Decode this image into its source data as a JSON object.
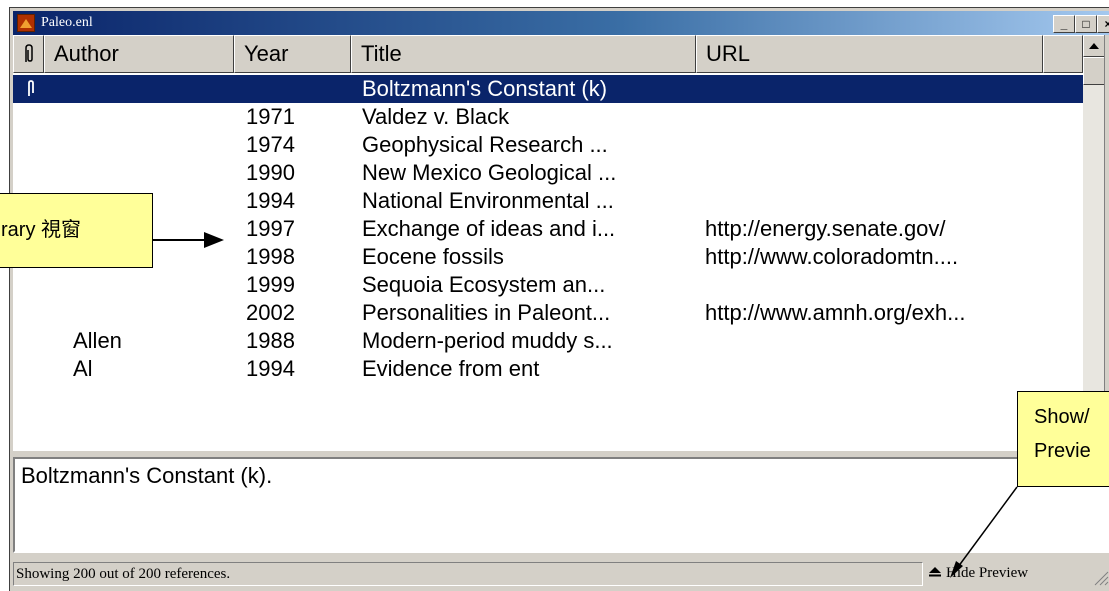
{
  "window": {
    "title": "Paleo.enl",
    "controls": {
      "minimize": "_",
      "maximize": "□",
      "close": "×"
    }
  },
  "columns": [
    {
      "label": "0"
    },
    {
      "label": "Author"
    },
    {
      "label": "Year"
    },
    {
      "label": "Title"
    },
    {
      "label": "URL"
    }
  ],
  "rows": [
    {
      "author": "",
      "year": "",
      "title": "Boltzmann's Constant (k)",
      "url": "",
      "selected": true
    },
    {
      "author": "",
      "year": "1971",
      "title": "Valdez v. Black",
      "url": ""
    },
    {
      "author": "",
      "year": "1974",
      "title": "Geophysical Research ...",
      "url": ""
    },
    {
      "author": "",
      "year": "1990",
      "title": "New Mexico Geological ...",
      "url": ""
    },
    {
      "author": "",
      "year": "1994",
      "title": "National Environmental ...",
      "url": ""
    },
    {
      "author": "",
      "year": "1997",
      "title": "Exchange of ideas and i...",
      "url": "http://energy.senate.gov/"
    },
    {
      "author": "",
      "year": "1998",
      "title": "Eocene fossils",
      "url": "http://www.coloradomtn...."
    },
    {
      "author": "",
      "year": "1999",
      "title": "Sequoia Ecosystem an...",
      "url": ""
    },
    {
      "author": "",
      "year": "2002",
      "title": "Personalities in Paleont...",
      "url": "http://www.amnh.org/exh..."
    },
    {
      "author": "Allen",
      "year": "1988",
      "title": "Modern-period muddy s...",
      "url": ""
    },
    {
      "author": "Al",
      "year": "1994",
      "title": "Evidence from ent",
      "url": ""
    }
  ],
  "preview": {
    "text": "Boltzmann's Constant (k)."
  },
  "status": {
    "text": "Showing 200 out of 200 references.",
    "hide_preview_label": "Hide Preview"
  },
  "callouts": {
    "library": "rary 視窗",
    "show_preview_line1": "Show/",
    "show_preview_line2": "Previe"
  },
  "icons": {
    "attachment_header": "paperclip-icon",
    "attachment_row": "attachment-icon",
    "hide_preview": "triangle-up-icon"
  },
  "colors": {
    "title_bar": "#0a246a",
    "selection": "#0a246a",
    "callout": "#ffff99"
  }
}
